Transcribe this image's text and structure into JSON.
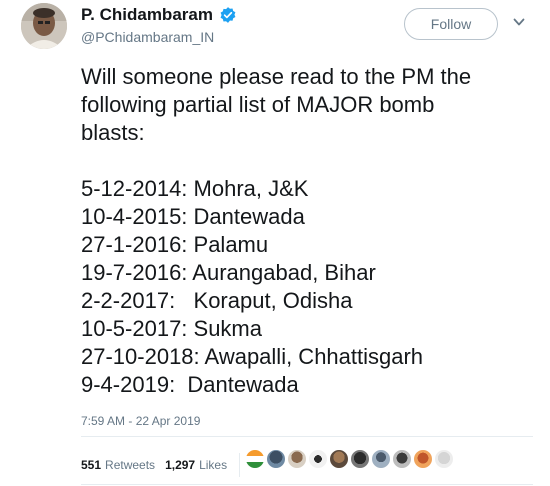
{
  "user": {
    "display_name": "P. Chidambaram",
    "handle": "@PChidambaram_IN",
    "verified_icon": "verified-badge-icon",
    "avatar_icon": "profile-avatar"
  },
  "follow_label": "Follow",
  "tweet_lines": [
    "Will someone please read to the PM the",
    "following partial list of MAJOR bomb",
    "blasts:",
    "",
    "5-12-2014: Mohra, J&K",
    "10-4-2015: Dantewada",
    "27-1-2016: Palamu",
    "19-7-2016: Aurangabad, Bihar",
    "2-2-2017:   Koraput, Odisha",
    "10-5-2017: Sukma",
    "27-10-2018: Awapalli, Chhattisgarh",
    "9-4-2019:  Dantewada"
  ],
  "timestamp": "7:59 AM - 22 Apr 2019",
  "stats": {
    "retweets_count": "551",
    "retweets_label": "Retweets",
    "likes_count": "1,297",
    "likes_label": "Likes"
  },
  "colors": {
    "accent": "#1da1f2",
    "secondary_text": "#657786",
    "divider": "#e6ecf0"
  }
}
